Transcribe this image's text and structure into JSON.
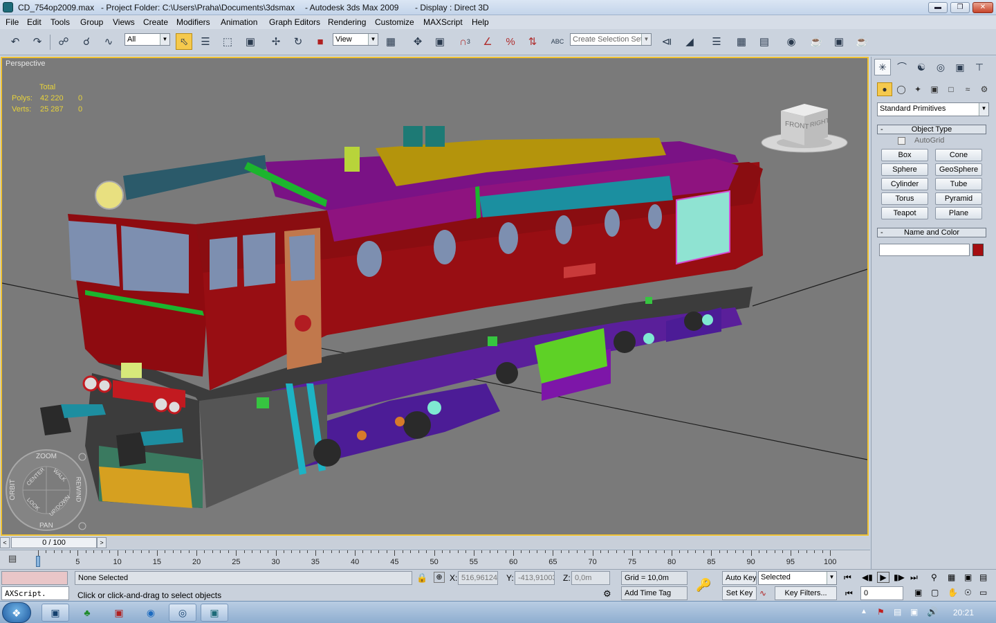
{
  "window": {
    "file": "CD_754op2009.max",
    "project": "- Project Folder: C:\\Users\\Praha\\Documents\\3dsmax",
    "app": "- Autodesk 3ds Max  2009",
    "display": "- Display : Direct 3D"
  },
  "menu": [
    "File",
    "Edit",
    "Tools",
    "Group",
    "Views",
    "Create",
    "Modifiers",
    "Animation",
    "Graph Editors",
    "Rendering",
    "Customize",
    "MAXScript",
    "Help"
  ],
  "toolbar": {
    "selection_filter": "All",
    "ref_coord": "View",
    "selection_set_placeholder": "Create Selection Set",
    "snap_label": "3",
    "angle_snap": "3",
    "percent_snap": "%"
  },
  "viewport": {
    "label": "Perspective",
    "stats_header": "Total",
    "polys_label": "Polys:",
    "polys_total": "42 220",
    "polys_sel": "0",
    "verts_label": "Verts:",
    "verts_total": "25 287",
    "verts_sel": "0",
    "viewcube_front": "FRONT",
    "viewcube_right": "RIGHT",
    "wheel": {
      "zoom": "ZOOM",
      "orbit": "ORBIT",
      "pan": "PAN",
      "rewind": "REWIND",
      "center": "CENTER",
      "walk": "WALK",
      "look": "LOOK",
      "updown": "UP/DOWN"
    }
  },
  "command_panel": {
    "category": "Standard Primitives",
    "object_type_title": "Object Type",
    "autogrid": "AutoGrid",
    "buttons": [
      "Box",
      "Cone",
      "Sphere",
      "GeoSphere",
      "Cylinder",
      "Tube",
      "Torus",
      "Pyramid",
      "Teapot",
      "Plane"
    ],
    "name_color_title": "Name and Color",
    "name_value": "",
    "object_color": "#a50d10"
  },
  "timeline": {
    "frame_display": "0 / 100",
    "ticks": [
      "0",
      "5",
      "10",
      "15",
      "20",
      "25",
      "30",
      "35",
      "40",
      "45",
      "50",
      "55",
      "60",
      "65",
      "70",
      "75",
      "80",
      "85",
      "90",
      "95",
      "100"
    ]
  },
  "status": {
    "maxscript": "AXScript.",
    "selection": "None Selected",
    "prompt": "Click or click-and-drag to select objects",
    "x_label": "X:",
    "x": "516,96124",
    "y_label": "Y:",
    "y": "-413,91003",
    "z_label": "Z:",
    "z": "0,0m",
    "grid": "Grid = 10,0m",
    "add_time_tag": "Add Time Tag",
    "auto_key": "Auto Key",
    "set_key": "Set Key",
    "key_mode": "Selected",
    "key_filters": "Key Filters...",
    "current_frame": "0"
  },
  "taskbar": {
    "clock": "20:21"
  }
}
